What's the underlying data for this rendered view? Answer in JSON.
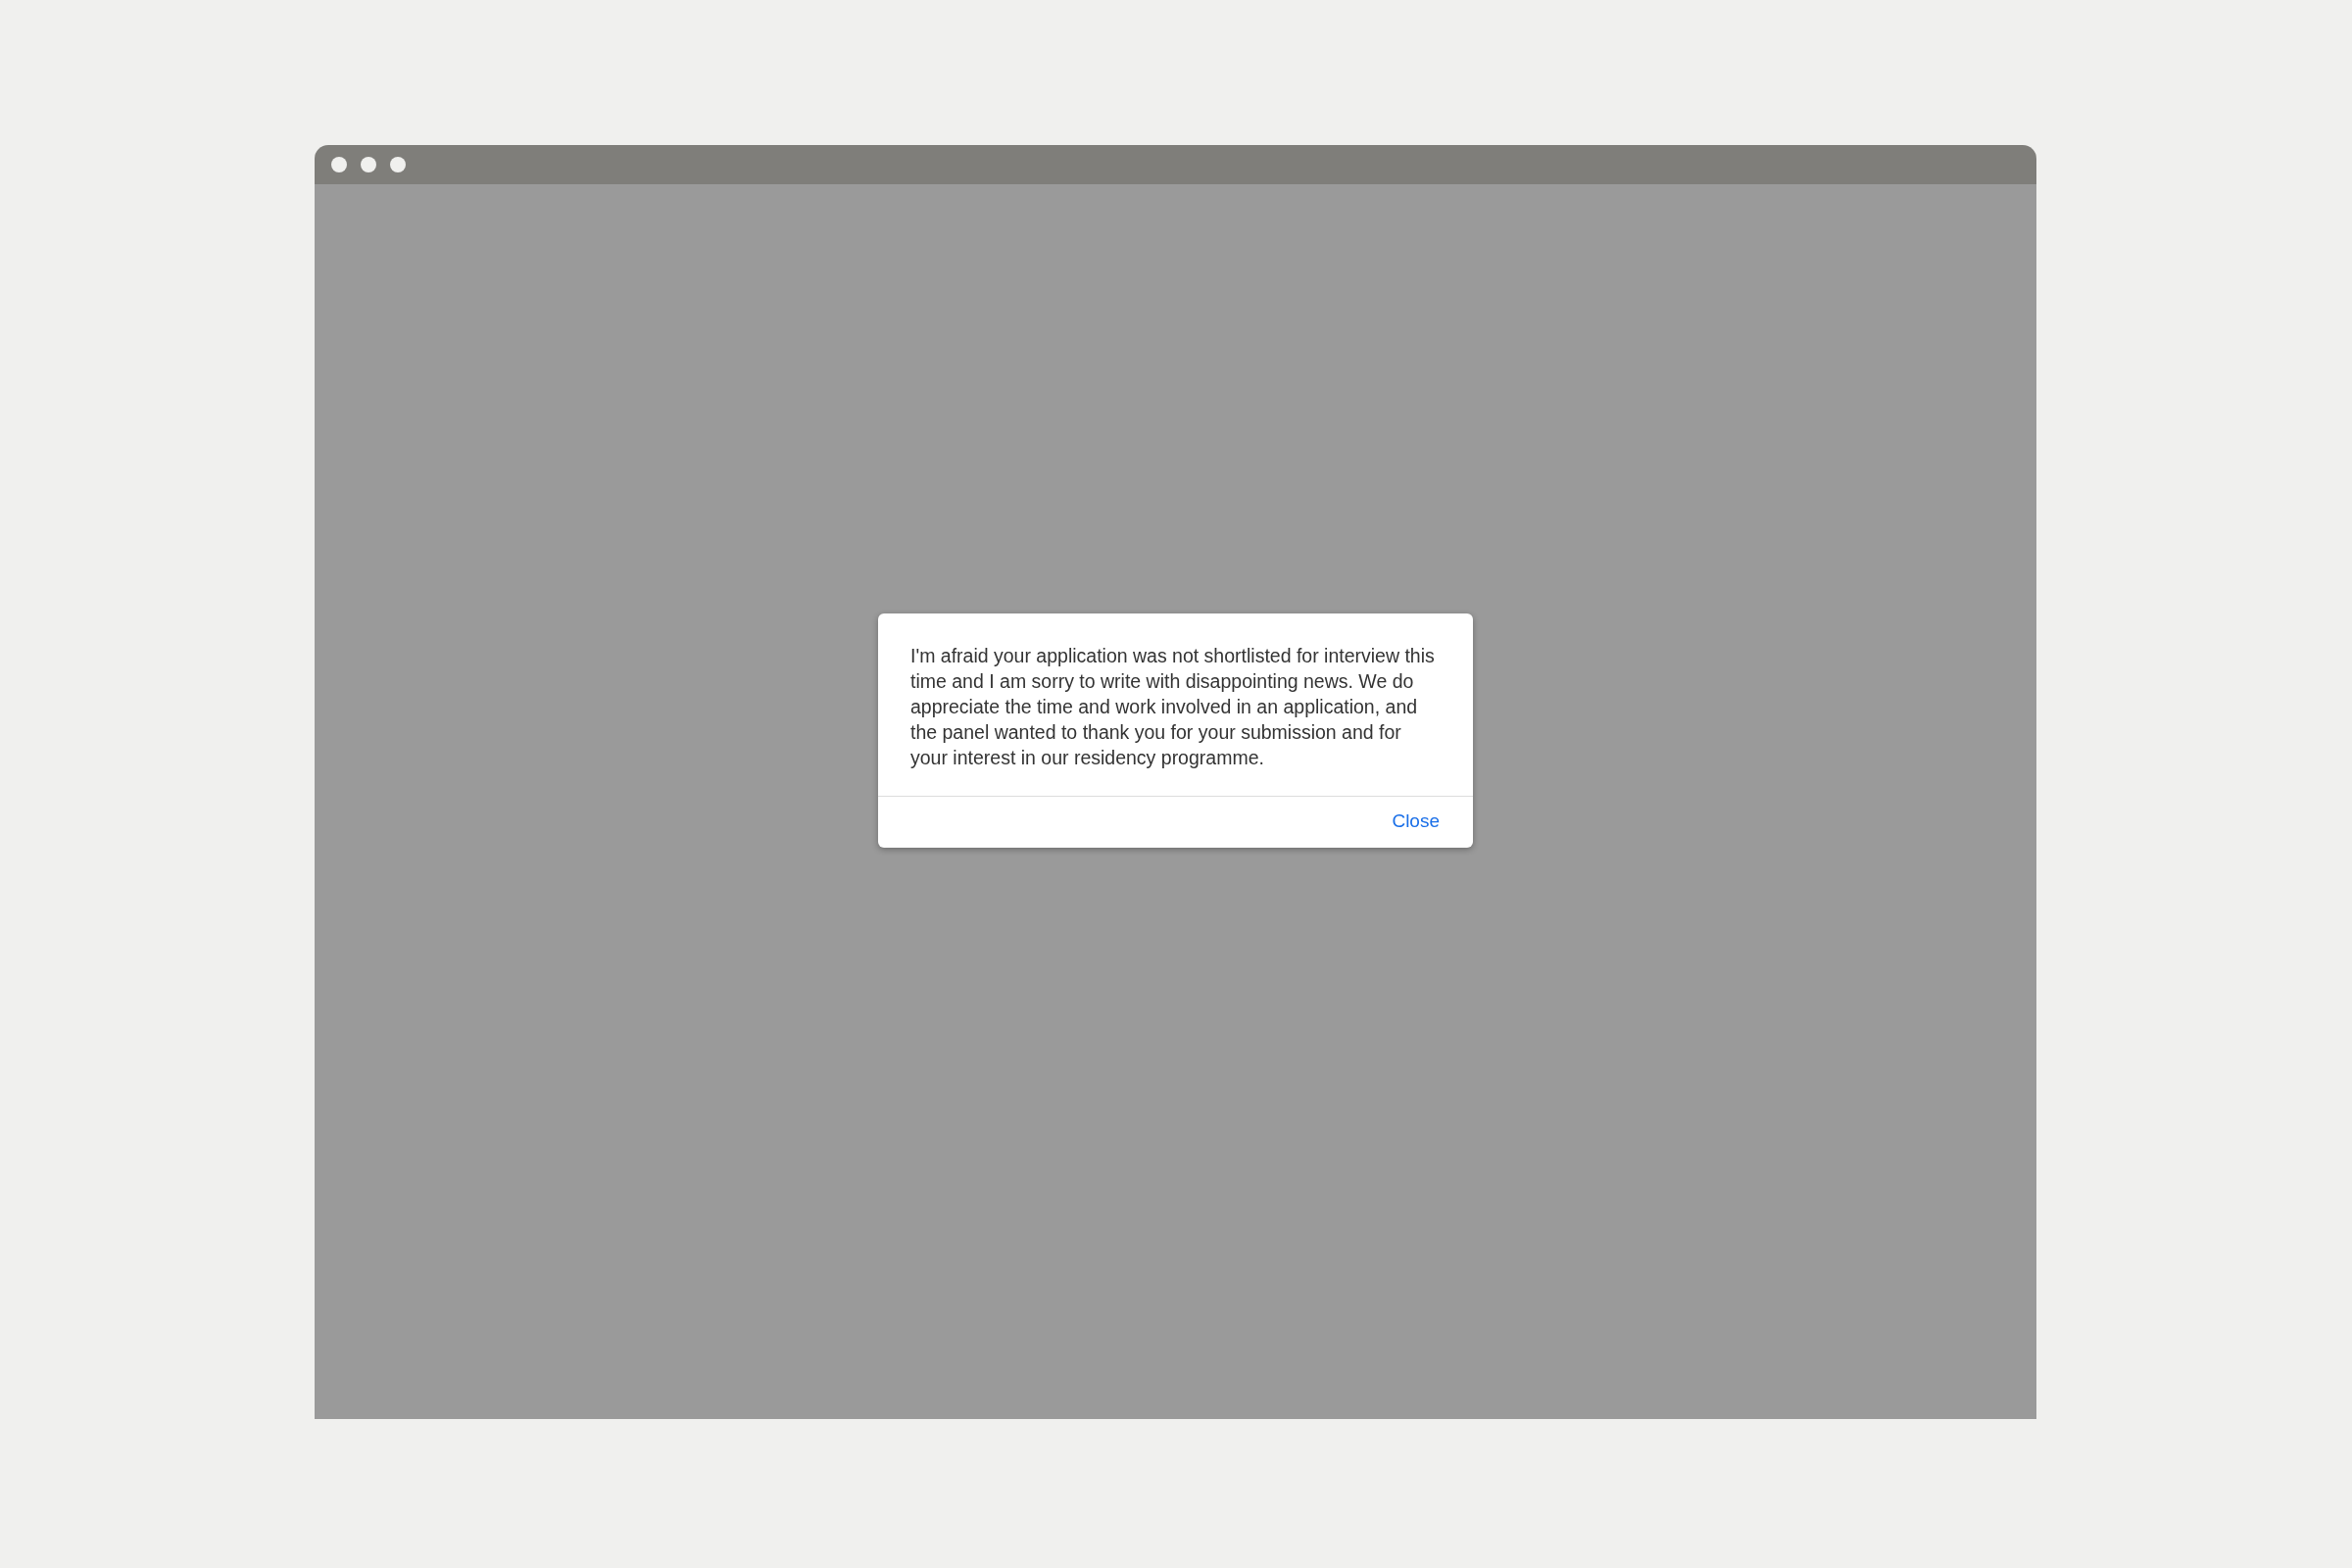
{
  "dialog": {
    "message": "I'm afraid your application was not shortlisted for interview this time and I am sorry to write with disappointing news. We do appreciate the time and work involved in an application, and the panel wanted to thank you for your submission and for your interest in our residency programme.",
    "buttons": [
      {
        "label": "Close"
      }
    ]
  }
}
